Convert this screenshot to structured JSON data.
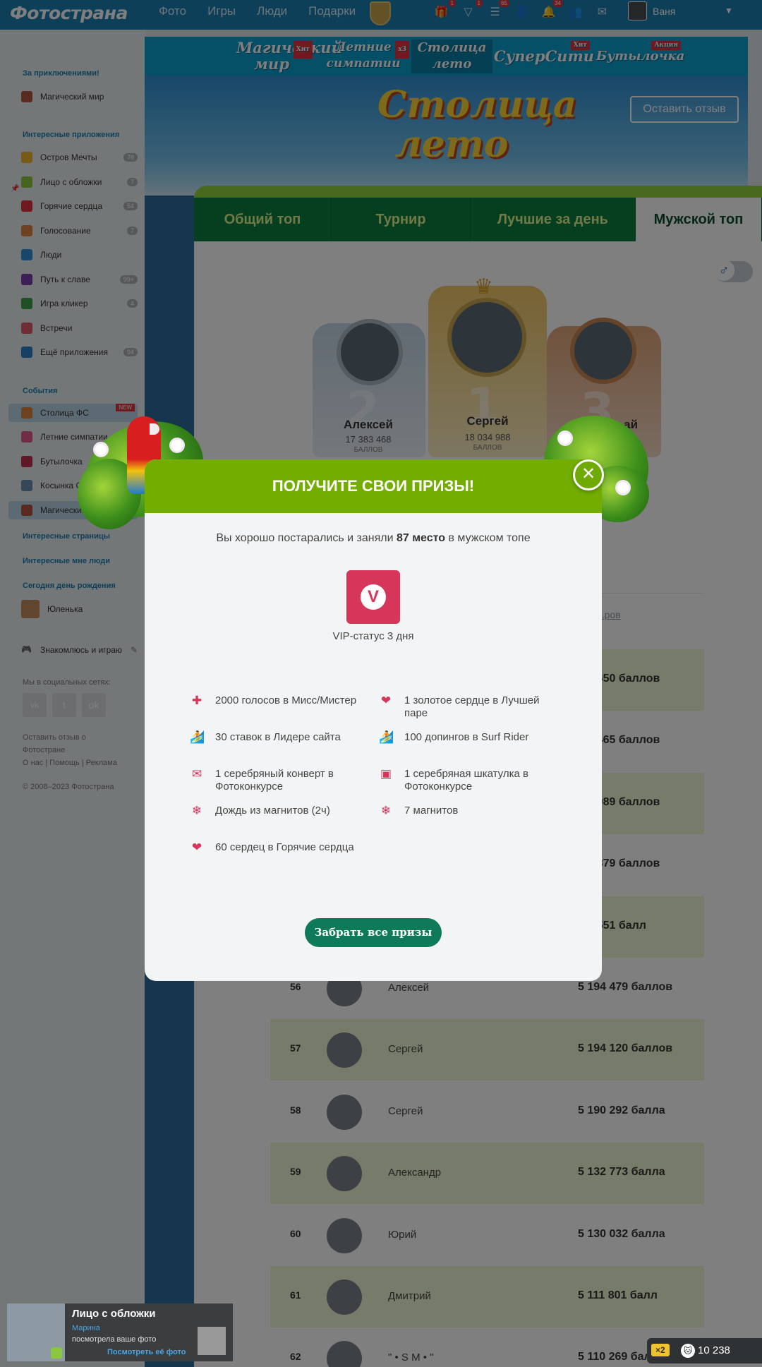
{
  "header": {
    "logo": "Фотострана",
    "nav": [
      "Фото",
      "Игры",
      "Люди",
      "Подарки"
    ],
    "icons": [
      {
        "icon": "gift-icon",
        "count": "1"
      },
      {
        "icon": "diamond-icon",
        "count": "1"
      },
      {
        "icon": "list-icon",
        "count": "65"
      },
      {
        "icon": "person-icon",
        "count": ""
      },
      {
        "icon": "bell-icon",
        "count": "34"
      },
      {
        "icon": "people-icon",
        "count": ""
      },
      {
        "icon": "mail-icon",
        "count": ""
      }
    ],
    "user": "Ваня"
  },
  "sidebar": {
    "sec_adventures": "За приключениями!",
    "adventure_item": "Магический мир",
    "sec_apps": "Интересные приложения",
    "apps": [
      {
        "label": "Остров Мечты",
        "count": "78",
        "color": "#f0b22e"
      },
      {
        "label": "Лицо с обложки",
        "count": "7",
        "color": "#8cc63f"
      },
      {
        "label": "Горячие сердца",
        "count": "54",
        "color": "#e0323c"
      },
      {
        "label": "Голосование",
        "count": "7",
        "color": "#e0823c"
      },
      {
        "label": "Люди",
        "count": "",
        "color": "#2d8fd8"
      },
      {
        "label": "Путь к славе",
        "count": "99+",
        "color": "#7a3fb0"
      },
      {
        "label": "Игра кликер",
        "count": "4",
        "color": "#3fa04a"
      },
      {
        "label": "Встречи",
        "count": "",
        "color": "#e05a6c"
      },
      {
        "label": "Ещё приложения",
        "count": "94",
        "color": "#2d7fc8"
      }
    ],
    "sec_events": "События",
    "events": [
      {
        "label": "Столица ФС",
        "new": "NEW"
      },
      {
        "label": "Летние симпатии",
        "new": ""
      },
      {
        "label": "Бутылочка",
        "new": ""
      },
      {
        "label": "Косынка Онлайн",
        "new": ""
      },
      {
        "label": "Магический мир",
        "new": ""
      }
    ],
    "sec_pages": "Интересные страницы",
    "sec_people": "Интересные мне люди",
    "sec_birthday": "Сегодня день рождения",
    "birthday_person": "Юленька",
    "meet_play": "Знакомлюсь и играю",
    "social_label": "Мы в социальных сетях:",
    "review_link": "Оставить отзыв о Фотостране",
    "footer_links": "О нас | Помощь | Реклама",
    "copyright": "© 2008–2023 Фотострана"
  },
  "promo": {
    "items": [
      {
        "label": "Магический мир",
        "tag": "Хит"
      },
      {
        "label": "Летние симпатии",
        "tag": "x3"
      },
      {
        "label": "Столица лето",
        "tag": ""
      },
      {
        "label": "СуперСити",
        "tag": "Хит"
      },
      {
        "label": "Бутылочка",
        "tag": "Акция"
      }
    ]
  },
  "hero": {
    "title": "Столица лето",
    "review_button": "Оставить отзыв"
  },
  "tabs": [
    "Общий топ",
    "Турнир",
    "Лучшие за день",
    "Мужской топ"
  ],
  "gender_toggle": "♂",
  "podium": [
    {
      "place": "2",
      "name": "Алексей",
      "score": "17 383 468",
      "label": "БАЛЛОВ"
    },
    {
      "place": "1",
      "name": "Сергей",
      "score": "18 034 988",
      "label": "БАЛЛОВ"
    },
    {
      "place": "3",
      "name": "...ай",
      "score": "",
      "label": ""
    }
  ],
  "table_header_link": "...ров",
  "leaderboard": [
    {
      "rank": "",
      "name": "",
      "points": "...4 650 баллов"
    },
    {
      "rank": "",
      "name": "",
      "points": "...8 465 баллов"
    },
    {
      "rank": "",
      "name": "",
      "points": "...2 089 баллов"
    },
    {
      "rank": "",
      "name": "",
      "points": "...1 879 баллов"
    },
    {
      "rank": "",
      "name": "",
      "points": "...4 551 балл"
    },
    {
      "rank": "56",
      "name": "Алексей",
      "points": "5 194 479 баллов"
    },
    {
      "rank": "57",
      "name": "Сергей",
      "points": "5 194 120 баллов"
    },
    {
      "rank": "58",
      "name": "Сергей",
      "points": "5 190 292 балла"
    },
    {
      "rank": "59",
      "name": "Александр",
      "points": "5 132 773 балла"
    },
    {
      "rank": "60",
      "name": "Юрий",
      "points": "5 130 032 балла"
    },
    {
      "rank": "61",
      "name": "Дмитрий",
      "points": "5 111 801 балл"
    },
    {
      "rank": "62",
      "name": "\" • S M • \"",
      "points": "5 110 269 баллов"
    }
  ],
  "modal": {
    "title": "ПОЛУЧИТЕ СВОИ ПРИЗЫ!",
    "subtitle_before": "Вы хорошо постарались и заняли ",
    "subtitle_place": "87 место",
    "subtitle_after": " в мужском топе",
    "vip_label": "VIP-статус 3 дня",
    "prizes": [
      {
        "icon": "cross-icon",
        "glyph": "✚",
        "text": "2000 голосов в Мисс/Мистер"
      },
      {
        "icon": "heart-icon",
        "glyph": "❤",
        "text": "1 золотое сердце в Лучшей паре"
      },
      {
        "icon": "surfer-icon",
        "glyph": "🏄",
        "text": "30 ставок в Лидере сайта"
      },
      {
        "icon": "surfer-icon",
        "glyph": "🏄",
        "text": "100 допингов в Surf Rider"
      },
      {
        "icon": "envelope-icon",
        "glyph": "✉",
        "text": "1 серебряный конверт в Фотоконкурсе"
      },
      {
        "icon": "box-icon",
        "glyph": "▣",
        "text": "1 серебряная шкатулка в Фотоконкурсе"
      },
      {
        "icon": "snowflake-icon",
        "glyph": "❄",
        "text": "Дождь из магнитов (2ч)"
      },
      {
        "icon": "snowflake-icon",
        "glyph": "❄",
        "text": "7 магнитов"
      },
      {
        "icon": "heart-icon",
        "glyph": "❤",
        "text": "60 сердец в Горячие сердца"
      }
    ],
    "claim_button": "Забрать все призы",
    "close_glyph": "✕"
  },
  "notification": {
    "title": "Лицо с обложки",
    "user": "Марина",
    "text": "посмотрела ваше фото",
    "link": "Посмотреть её фото"
  },
  "coins": {
    "multiplier": "×2",
    "value": "10 238"
  }
}
